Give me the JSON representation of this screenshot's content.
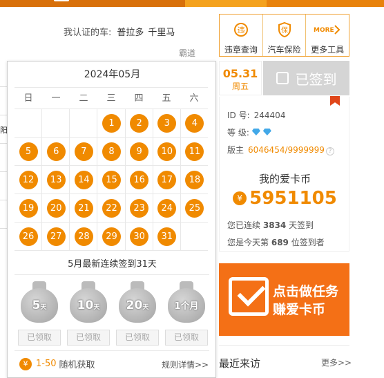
{
  "nav": {
    "active_color": "#f4a21e"
  },
  "my_car": {
    "label": "我认证的车:",
    "cars": [
      "普拉多",
      "千里马"
    ],
    "more_car": "霸道"
  },
  "calendar": {
    "title": "2024年05月",
    "weekdays": [
      "日",
      "一",
      "二",
      "三",
      "四",
      "五",
      "六"
    ],
    "rows": [
      [
        "",
        "",
        "",
        "1",
        "2",
        "3",
        "4"
      ],
      [
        "5",
        "6",
        "7",
        "8",
        "9",
        "10",
        "11"
      ],
      [
        "12",
        "13",
        "14",
        "15",
        "16",
        "17",
        "18"
      ],
      [
        "19",
        "20",
        "21",
        "22",
        "23",
        "24",
        "25"
      ],
      [
        "26",
        "27",
        "28",
        "29",
        "30",
        "31",
        ""
      ]
    ],
    "streak_text": "5月最新连续签到31天",
    "rewards": [
      {
        "label": "5",
        "unit": "天",
        "claim": "已领取"
      },
      {
        "label": "10",
        "unit": "天",
        "claim": "已领取"
      },
      {
        "label": "20",
        "unit": "天",
        "claim": "已领取"
      },
      {
        "label": "1个月",
        "unit": "",
        "claim": "已领取"
      }
    ],
    "random": {
      "coin": "¥",
      "range": "1-50",
      "text": "随机获取"
    },
    "rules_link": "规则详情>>"
  },
  "tools": [
    {
      "label": "违章查询",
      "icon": "violation-check-icon"
    },
    {
      "label": "汽车保险",
      "icon": "car-insurance-icon"
    },
    {
      "label": "更多工具",
      "icon": "more-tools-icon"
    }
  ],
  "sign": {
    "date": "05.31",
    "weekday": "周五",
    "status": "已签到"
  },
  "profile": {
    "id_label": "ID 号:",
    "id": "244404",
    "level_label": "等 级:",
    "owner_label": "版主",
    "owner_value": "6046454/9999999",
    "coin_title": "我的爱卡币",
    "coin_symbol": "¥",
    "coin_value": "5951105",
    "streak_prefix": "您已连续",
    "streak_days": "3834",
    "streak_suffix": "天签到",
    "rank_prefix": "您是今天第",
    "rank": "689",
    "rank_suffix": "位签到者"
  },
  "banner": {
    "line1": "点击做任务",
    "line2": "赚爱卡币",
    "color": "#f47016"
  },
  "recent": {
    "title": "最近来访",
    "more": "更多>>"
  },
  "accent": "#f08a00"
}
